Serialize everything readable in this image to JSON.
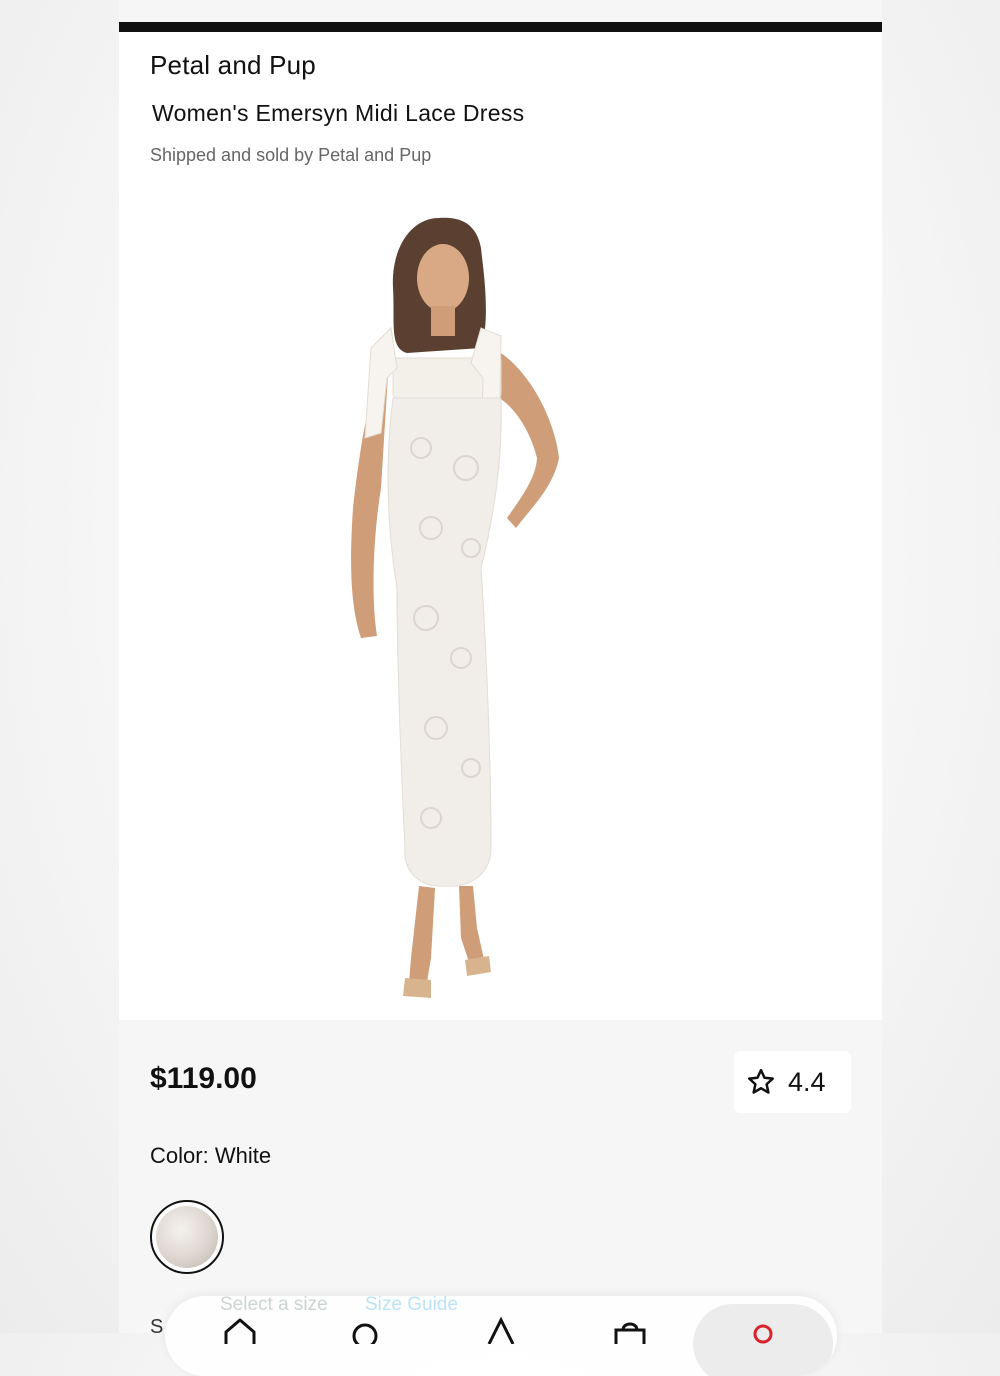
{
  "product": {
    "brand": "Petal and Pup",
    "title": "Women's Emersyn Midi Lace Dress",
    "seller": "Shipped and sold by Petal and Pup",
    "price": "$119.00",
    "rating": "4.4",
    "color_label": "Color:",
    "color_value": "White",
    "size_peek": "S"
  },
  "navbar": {
    "ghost_select_size": "Select a size",
    "ghost_size_guide": "Size Guide",
    "items": [
      "home-icon",
      "search-icon",
      "user-icon",
      "bag-icon",
      "account-icon"
    ]
  },
  "colors": {
    "accent": "#d8232a",
    "text": "#111111",
    "muted": "#666666",
    "link": "#8fd0f0"
  }
}
